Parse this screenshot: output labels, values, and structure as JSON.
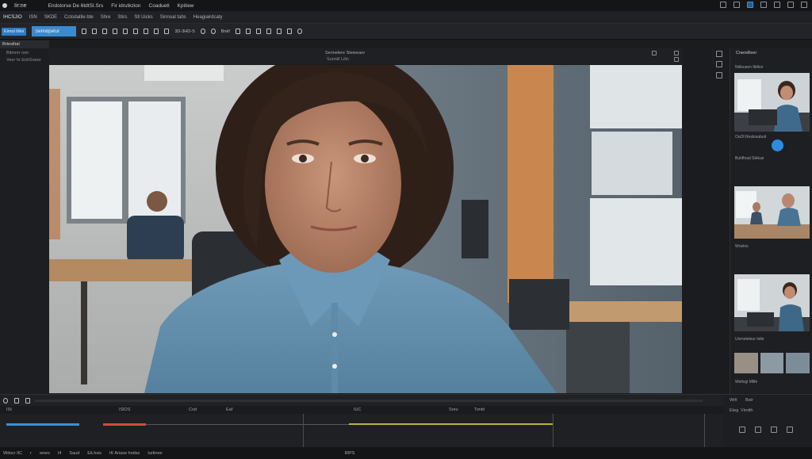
{
  "titlebar": {
    "title": "Iir:ne",
    "menu": [
      "Endstorse De 6tdtSI.Srs",
      "Fir idrutkzion",
      "Coaduetl",
      "Kpiitew"
    ]
  },
  "menubar": {
    "items": [
      "IHCSJIO",
      "ISN",
      "SKDE",
      "Cctodatile bte",
      "Shre",
      "Stirs",
      "Stl Uicks",
      "Sinnoal tabs",
      "Heagiairdcaty"
    ]
  },
  "toolbar": {
    "left_button": "Eimol Mini",
    "search_value": "Sefindpetur",
    "label_a": "3D-3HD-S",
    "label_b": "Bnkf"
  },
  "left_panel": {
    "tab": "Brtestlral",
    "items": [
      "Bitmnrr iom",
      "Veer hr EnhSoeer"
    ]
  },
  "viewer": {
    "title": "Sennelere Steieeaor",
    "subtitle": "Sunnill Lilin"
  },
  "preview_panel": {
    "title": "Cnerelliver",
    "labels": [
      "Ndlsusen Ibilkor",
      "OuOl Reslosubuit",
      "Buhfhoal Slekue",
      "Wnelns",
      "Unrnsteleur tolle",
      "Weltvgi Mllfe"
    ]
  },
  "timeline": {
    "progress": 0.0,
    "ruler_labels": [
      "ISt",
      "ISlOS",
      "Cod",
      "Eaf",
      "IUC",
      "Sreu",
      "Tontit"
    ],
    "status": [
      "Wdscr IIC",
      "r",
      "wnes",
      "I4",
      "Saud",
      "EiLhsis",
      "IK Ariase hodss",
      "Iurtinee",
      "IRPS"
    ],
    "side_labels": [
      "Wrlt",
      "Bstr",
      "Eteg",
      "Viroith"
    ]
  },
  "colors": {
    "accent": "#2b7dc6",
    "panel": "#1e1f22",
    "track_blue": "#3d8fd3",
    "track_red": "#d24a3f",
    "track_yellow": "#b9b03c"
  }
}
